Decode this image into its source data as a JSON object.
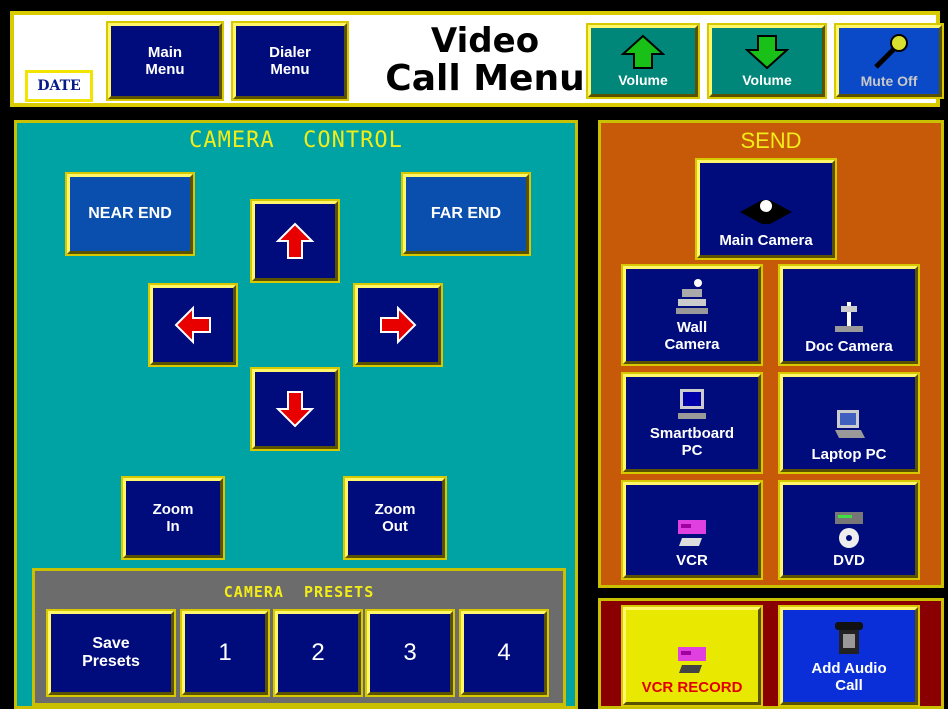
{
  "header": {
    "date_label": "DATE",
    "main_menu": [
      "Main",
      "Menu"
    ],
    "dialer_menu": [
      "Dialer",
      "Menu"
    ],
    "title": [
      "Video",
      "Call Menu"
    ],
    "volume_up_label": "Volume",
    "volume_down_label": "Volume",
    "mute_label": "Mute Off"
  },
  "camera_control": {
    "title": "CAMERA  CONTROL",
    "near_end": "NEAR END",
    "far_end": "FAR END",
    "zoom_in": [
      "Zoom",
      "In"
    ],
    "zoom_out": [
      "Zoom",
      "Out"
    ]
  },
  "presets": {
    "title": "CAMERA  PRESETS",
    "save": [
      "Save",
      "Presets"
    ],
    "numbers": [
      "1",
      "2",
      "3",
      "4"
    ]
  },
  "send": {
    "title": "SEND",
    "main_camera": "Main Camera",
    "wall_camera": [
      "Wall",
      "Camera"
    ],
    "doc_camera": "Doc Camera",
    "smartboard": [
      "Smartboard",
      "PC"
    ],
    "laptop": "Laptop PC",
    "vcr": "VCR",
    "dvd": "DVD"
  },
  "record": {
    "vcr_record": "VCR RECORD",
    "add_audio": [
      "Add Audio",
      "Call"
    ]
  },
  "colors": {
    "header_border": "#d8cb00",
    "camera_panel": "#00a3a3",
    "send_panel": "#c65a08",
    "record_panel": "#8a0000",
    "button_navy": "#000c7c",
    "arrow_red": "#e80000"
  }
}
